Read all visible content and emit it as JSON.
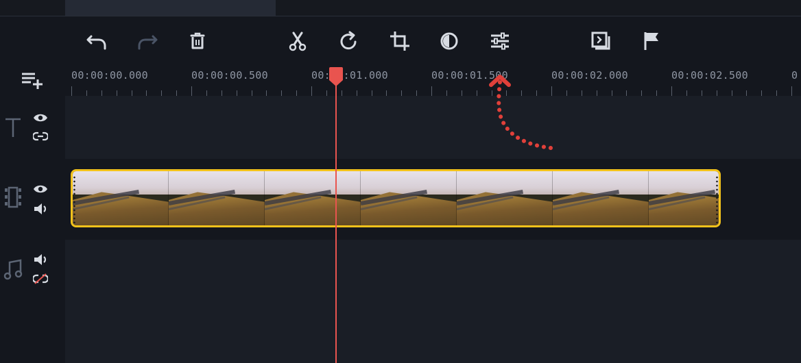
{
  "colors": {
    "background": "#14171e",
    "lane": "#1a1e26",
    "clip_border": "#f2c21b",
    "playhead": "#e9544f",
    "icon_active": "#d7dbe2",
    "icon_disabled": "#4a5466",
    "annotation_arrow": "#e0403a"
  },
  "toolbar": {
    "buttons": [
      {
        "name": "undo-icon",
        "enabled": true
      },
      {
        "name": "redo-icon",
        "enabled": false
      },
      {
        "name": "trash-icon",
        "enabled": true
      },
      {
        "name": "scissors-icon",
        "enabled": true
      },
      {
        "name": "rotate-icon",
        "enabled": true
      },
      {
        "name": "crop-icon",
        "enabled": true
      },
      {
        "name": "color-adjust-icon",
        "enabled": true
      },
      {
        "name": "sliders-icon",
        "enabled": true
      },
      {
        "name": "clip-properties-icon",
        "enabled": true
      },
      {
        "name": "flag-icon",
        "enabled": true
      }
    ]
  },
  "ruler": {
    "labels": [
      "00:00:00.000",
      "00:00:00.500",
      "00:00:01.000",
      "00:00:01.500",
      "00:00:02.000",
      "00:00:02.500",
      "0"
    ]
  },
  "tracks": [
    {
      "type": "text",
      "icon": "text-track-icon",
      "controls": [
        "eye-icon",
        "link-icon"
      ]
    },
    {
      "type": "video",
      "icon": "video-track-icon",
      "controls": [
        "eye-icon",
        "speaker-icon"
      ]
    },
    {
      "type": "audio",
      "icon": "music-note-icon",
      "controls": [
        "speaker-icon",
        "unlink-icon"
      ]
    }
  ],
  "playhead": {
    "time": "00:00:01.000"
  },
  "clip": {
    "frame_count": 7
  }
}
